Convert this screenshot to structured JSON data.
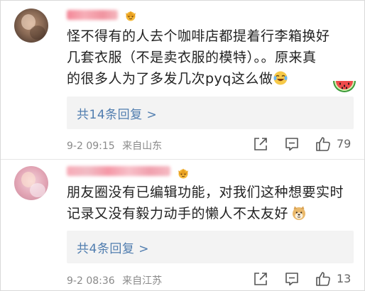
{
  "comments": [
    {
      "text_line1": "怪不得有的人去个咖啡店都提着行李箱换好",
      "text_line2": "几套衣服（不是卖衣服的模特）。。原来真",
      "text_line3": "的很多人为了多发几次pyq这么做",
      "reply_label": "共14条回复 >",
      "date": "9-2 09:15",
      "location": "来自山东",
      "likes": "79",
      "inline_emoji": "laughing-crying-emoji",
      "sticker": "watermelon-emoji"
    },
    {
      "text_line1": "朋友圈没有已编辑功能，对我们这种想要实时",
      "text_line2": "记录又没有毅力动手的懒人不太友好",
      "reply_label": "共4条回复 >",
      "date": "9-2 08:36",
      "location": "来自江苏",
      "likes": "13",
      "inline_emoji": "doge-emoji"
    }
  ],
  "colors": {
    "link": "#507daf",
    "text": "#222222",
    "meta": "#8a8a8a",
    "reply_bg": "#f3f3f3"
  }
}
